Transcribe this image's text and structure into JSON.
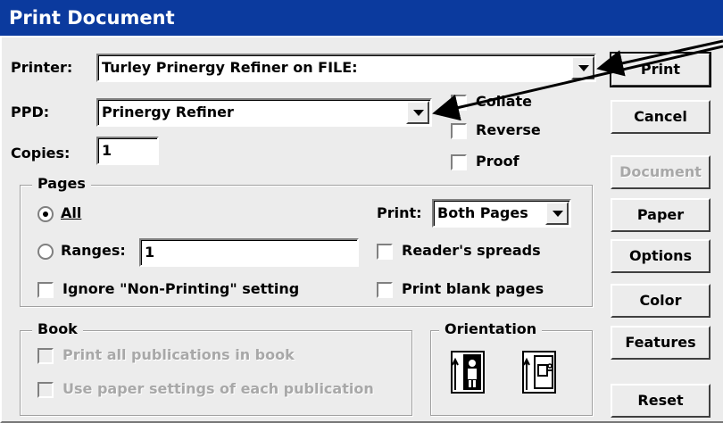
{
  "window": {
    "title": "Print Document"
  },
  "printer": {
    "label": "Printer:",
    "value": "Turley Prinergy Refiner on FILE:"
  },
  "ppd": {
    "label": "PPD:",
    "value": "Prinergy Refiner"
  },
  "copies": {
    "label": "Copies:",
    "value": "1"
  },
  "options": {
    "collate": "Collate",
    "reverse": "Reverse",
    "proof": "Proof"
  },
  "pages": {
    "title": "Pages",
    "all_label": "All",
    "ranges_label": "Ranges:",
    "ranges_value": "1",
    "print_label": "Print:",
    "print_value": "Both Pages",
    "readers_spreads": "Reader's spreads",
    "ignore_nonprinting": "Ignore \"Non-Printing\" setting",
    "print_blank": "Print blank pages"
  },
  "book": {
    "title": "Book",
    "print_all": "Print all publications in book",
    "use_paper": "Use paper settings of each publication"
  },
  "orientation": {
    "title": "Orientation"
  },
  "buttons": {
    "print": "Print",
    "cancel": "Cancel",
    "document": "Document",
    "paper": "Paper",
    "options": "Options",
    "color": "Color",
    "features": "Features",
    "reset": "Reset"
  }
}
